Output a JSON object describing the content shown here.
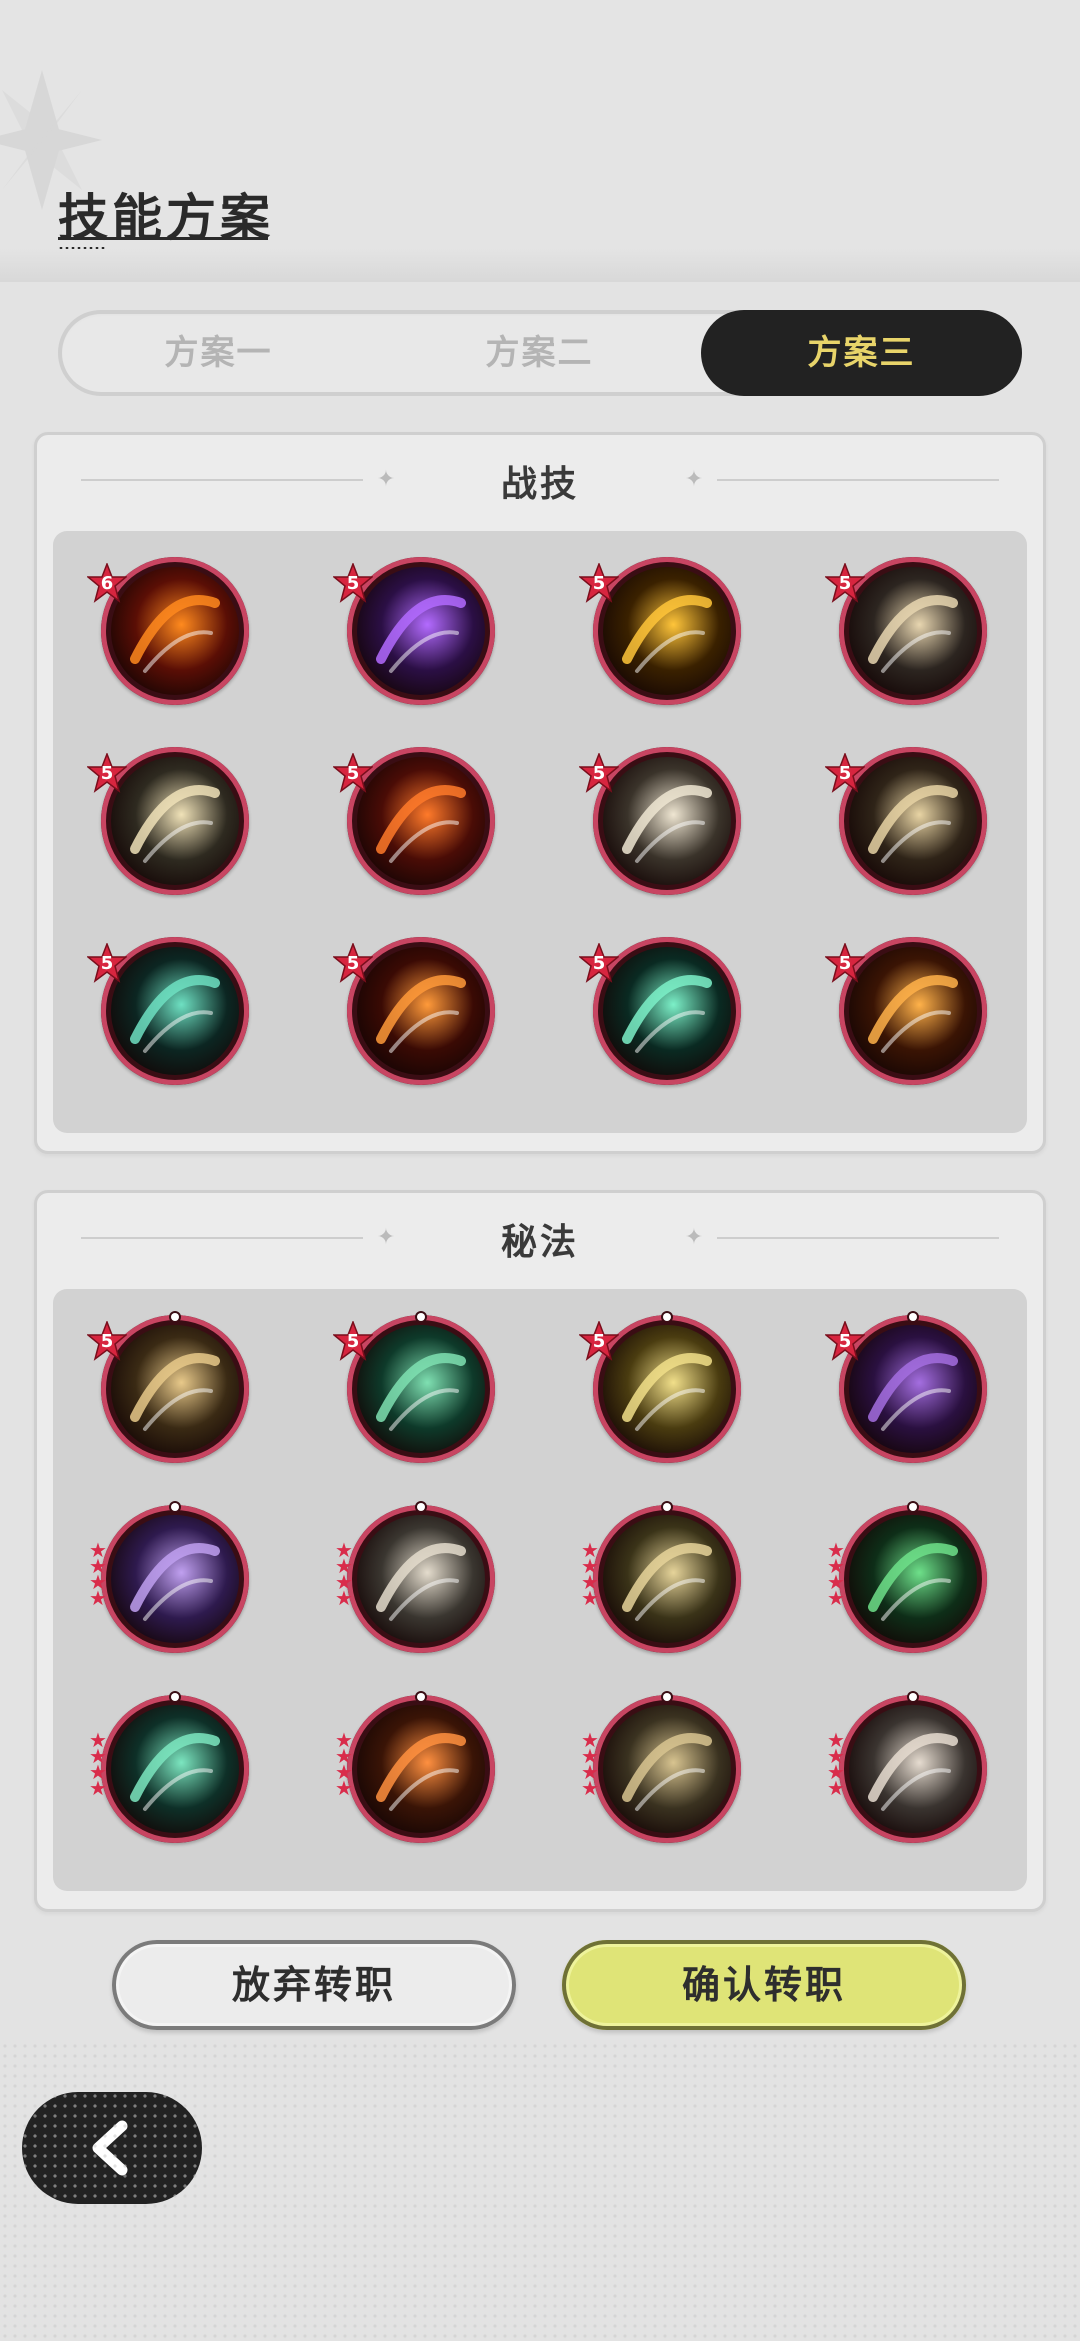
{
  "header": {
    "title": "技能方案"
  },
  "tabs": [
    {
      "label": "方案一",
      "active": false
    },
    {
      "label": "方案二",
      "active": false
    },
    {
      "label": "方案三",
      "active": true
    }
  ],
  "sections": {
    "combat": {
      "title": "战技"
    },
    "secret": {
      "title": "秘法"
    }
  },
  "combat_skills": [
    {
      "icon": "fire-swirl-icon",
      "level": "6",
      "colors": [
        "#5a0e05",
        "#ff8a1e"
      ]
    },
    {
      "icon": "purple-orb-icon",
      "level": "5",
      "colors": [
        "#2b0f45",
        "#b36bff"
      ]
    },
    {
      "icon": "golden-crescent-icon",
      "level": "5",
      "colors": [
        "#3a2100",
        "#ffc53a"
      ]
    },
    {
      "icon": "cross-slash-icon",
      "level": "5",
      "colors": [
        "#2c2520",
        "#e8d6b0"
      ]
    },
    {
      "icon": "lightning-slash-icon",
      "level": "5",
      "colors": [
        "#2e2a20",
        "#f0e2b8"
      ]
    },
    {
      "icon": "fire-emblem-icon",
      "level": "5",
      "colors": [
        "#4a0c06",
        "#ff7a2a"
      ]
    },
    {
      "icon": "charge-dash-icon",
      "level": "5",
      "colors": [
        "#3a332a",
        "#efe6d2"
      ]
    },
    {
      "icon": "scythe-icon",
      "level": "5",
      "colors": [
        "#2f2418",
        "#e8d4a4"
      ]
    },
    {
      "icon": "spider-web-icon",
      "level": "5",
      "colors": [
        "#0c2622",
        "#6ee0c2"
      ]
    },
    {
      "icon": "flame-arc-icon",
      "level": "5",
      "colors": [
        "#3a0a04",
        "#ff9a3a"
      ]
    },
    {
      "icon": "sword-burst-icon",
      "level": "5",
      "colors": [
        "#0a2a22",
        "#7cf0c8"
      ]
    },
    {
      "icon": "flame-ring-icon",
      "level": "5",
      "colors": [
        "#3a1404",
        "#ffb24a"
      ]
    }
  ],
  "secret_skills": [
    {
      "icon": "armor-icon",
      "level": "5",
      "stars": 0,
      "colors": [
        "#3a2a14",
        "#e8c98a"
      ]
    },
    {
      "icon": "heart-heal-icon",
      "level": "5",
      "stars": 0,
      "colors": [
        "#0e3a2a",
        "#7fe0b2"
      ]
    },
    {
      "icon": "heal-figure-icon",
      "level": "5",
      "stars": 0,
      "colors": [
        "#4a3c10",
        "#f1df8a"
      ]
    },
    {
      "icon": "dark-armor-icon",
      "level": "5",
      "stars": 0,
      "colors": [
        "#2a1040",
        "#a46ee0"
      ]
    },
    {
      "icon": "purple-spirit-icon",
      "level": "",
      "stars": 4,
      "colors": [
        "#2e1a4e",
        "#c0a0f0"
      ]
    },
    {
      "icon": "shield-figure-icon",
      "level": "",
      "stars": 4,
      "colors": [
        "#3a3630",
        "#e4dccd"
      ]
    },
    {
      "icon": "golem-icon",
      "level": "",
      "stars": 4,
      "colors": [
        "#3a3318",
        "#e6d49a"
      ]
    },
    {
      "icon": "green-leaf-icon",
      "level": "",
      "stars": 4,
      "colors": [
        "#0e2e18",
        "#6ee08a"
      ]
    },
    {
      "icon": "green-swirl-icon",
      "level": "",
      "stars": 4,
      "colors": [
        "#0e3028",
        "#7ce6c0"
      ]
    },
    {
      "icon": "fire-spirit-icon",
      "level": "",
      "stars": 4,
      "colors": [
        "#3a1406",
        "#ff9040"
      ]
    },
    {
      "icon": "serpent-icon",
      "level": "",
      "stars": 4,
      "colors": [
        "#3a3220",
        "#d8c490"
      ]
    },
    {
      "icon": "sword-relic-icon",
      "level": "",
      "stars": 4,
      "colors": [
        "#3a3430",
        "#e6dcd0"
      ]
    }
  ],
  "buttons": {
    "cancel": "放弃转职",
    "confirm": "确认转职",
    "back_icon": "chevron-left-icon"
  }
}
